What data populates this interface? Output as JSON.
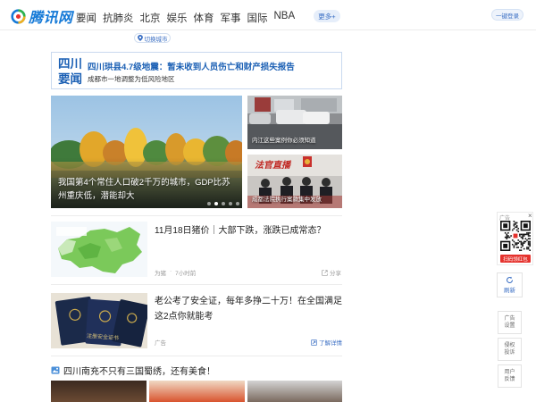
{
  "header": {
    "logo_text": "腾讯网",
    "nav": [
      {
        "label": "要闻"
      },
      {
        "label": "抗肺炎"
      },
      {
        "label": "北京"
      },
      {
        "label": "娱乐"
      },
      {
        "label": "体育"
      },
      {
        "label": "军事"
      },
      {
        "label": "国际"
      },
      {
        "label": "NBA"
      }
    ],
    "more_label": "更多+",
    "login_label": "一键登录"
  },
  "city": {
    "label": "切换城市"
  },
  "local_news": {
    "title_line1": "四川",
    "title_line2": "要闻",
    "headline": "四川珙县4.7级地震：暂未收到人员伤亡和财产损失报告",
    "subline": "成都市一地调整为低风险地区"
  },
  "carousel": {
    "caption": "我国第4个常住人口破2千万的城市，GDP比苏州重庆低，潜能却大",
    "slide_count": 5,
    "active_slide": 1
  },
  "side_stories": [
    {
      "caption": "内江这些案例你必须知道"
    },
    {
      "badge": "法官直播",
      "caption": "成都法院执行案款集中发放"
    }
  ],
  "feed": [
    {
      "title": "11月18日猪价｜大部下跌，涨跌已成常态？",
      "source": "为猪",
      "time": "7小时前",
      "action": "分享"
    },
    {
      "title": "老公考了安全证，每年多挣二十万！在全国满足这2点你就能考",
      "source": "广告",
      "action": "了解详情",
      "card_text": "注册安全证书"
    }
  ],
  "section": {
    "title": "四川南充不只有三国蜀绣，还有美食！"
  },
  "sidebar": {
    "ad_label": "广告",
    "close": "×",
    "qr_button": "扫码领红包",
    "refresh": "刷新",
    "ad_settings": [
      "广告",
      "设置"
    ],
    "complaint": [
      "侵权",
      "投诉"
    ],
    "feedback": [
      "用户",
      "反馈"
    ]
  },
  "colors": {
    "brand_blue": "#1479d7",
    "headline_blue": "#1a5fb4",
    "ad_red": "#e5322d"
  }
}
